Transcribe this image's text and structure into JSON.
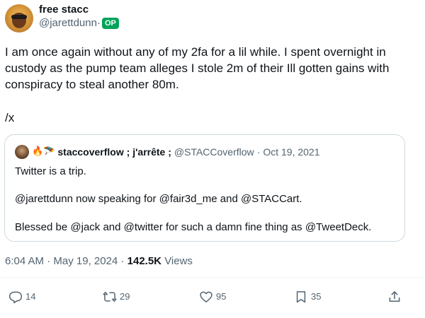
{
  "post": {
    "author": {
      "display_name": "free stacc",
      "handle": "@jarettdunn",
      "separator": "·",
      "badge": "OP"
    },
    "text": "I am once again without any of my 2fa for a lil while. I spent overnight in\ncustody as the pump team alleges I stole 2m of their Ill gotten gains with\nconspiracy to steal another 80m.",
    "signoff": "/x",
    "quote": {
      "emojis": "🔥🪂",
      "author_name": "staccoverflow ; j'arrête ;",
      "author_handle": "@STACCoverflow",
      "separator": "·",
      "date": "Oct 19, 2021",
      "line1": "Twitter is a trip.",
      "line2": "@jarettdunn now speaking for @fair3d_me and @STACCart.",
      "line3": "Blessed be @jack and @twitter for such a damn fine thing as @TweetDeck."
    },
    "meta": {
      "time": "6:04 AM",
      "separator": "·",
      "date": "May 19, 2024",
      "separator2": "·",
      "views_count": "142.5K",
      "views_label": "Views"
    },
    "actions": {
      "reply_count": "14",
      "repost_count": "29",
      "like_count": "95",
      "bookmark_count": "35"
    },
    "icons": {
      "reply": "reply-icon",
      "repost": "repost-icon",
      "like": "heart-icon",
      "bookmark": "bookmark-icon",
      "share": "share-icon"
    },
    "colors": {
      "text": "#0f1419",
      "secondary": "#536471",
      "badge": "#00a35a",
      "border": "#cfd9de"
    }
  }
}
